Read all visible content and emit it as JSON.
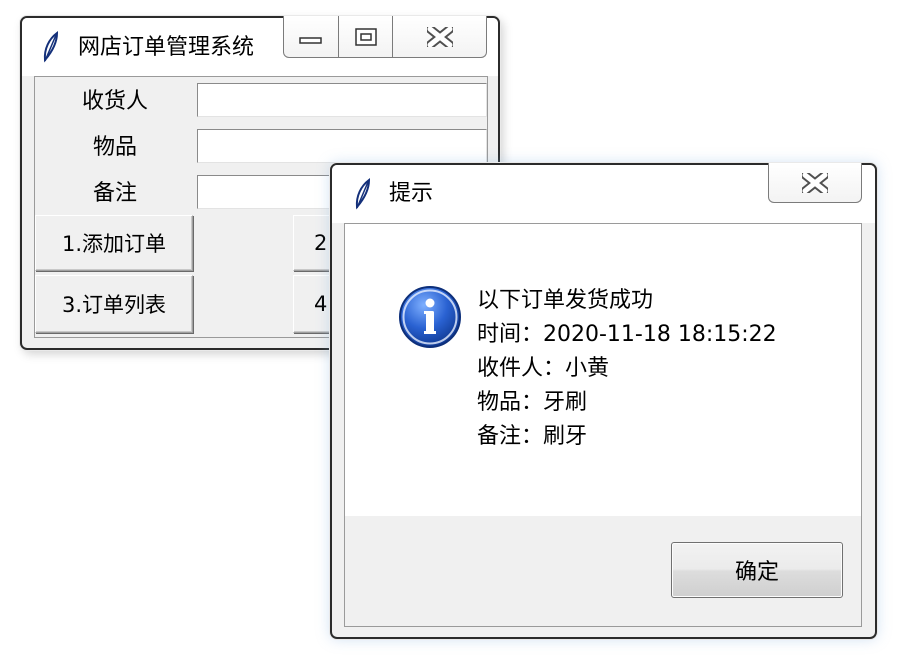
{
  "main_window": {
    "title": "网店订单管理系统",
    "icon": "feather-icon",
    "caption_buttons": [
      "minimize-icon",
      "maximize-icon",
      "close-icon"
    ],
    "fields": [
      {
        "label": "收货人",
        "value": ""
      },
      {
        "label": "物品",
        "value": ""
      },
      {
        "label": "备注",
        "value": ""
      }
    ],
    "buttons": {
      "add_order": "1.添加订单",
      "order_list": "3.订单列表",
      "btn2_partial": "2",
      "btn4_partial": "4"
    }
  },
  "dialog": {
    "title": "提示",
    "icon": "feather-icon",
    "info_icon": "info-icon",
    "message_lines": [
      "以下订单发货成功",
      "时间：2020-11-18 18:15:22",
      "收件人：小黄",
      "物品：牙刷",
      "备注：刷牙"
    ],
    "ok_label": "确定"
  },
  "colors": {
    "window_bg": "#f0f0f0",
    "title_bg": "#ffffff",
    "info_blue": "#1c4fb0"
  }
}
